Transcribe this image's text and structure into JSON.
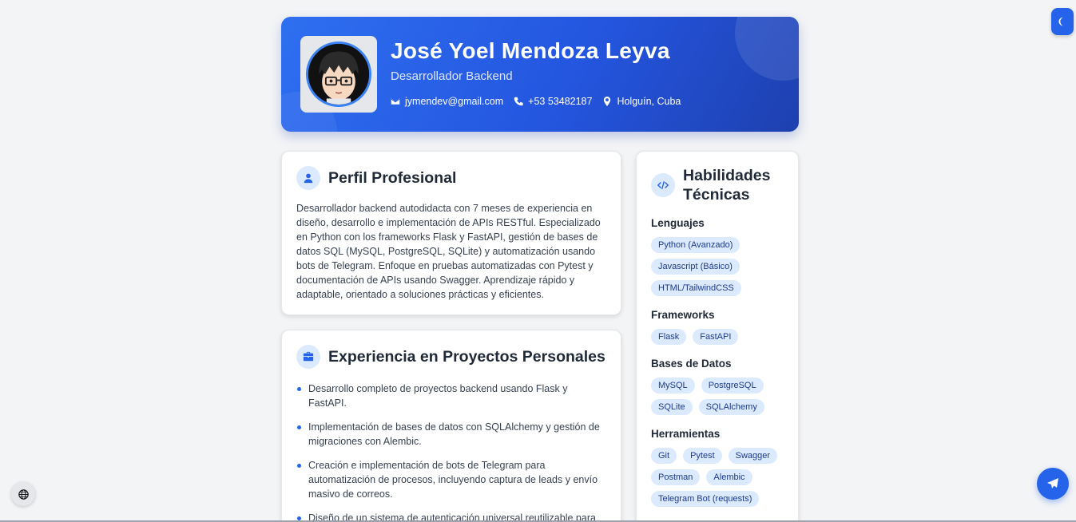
{
  "header": {
    "name": "José Yoel Mendoza Leyva",
    "role": "Desarrollador Backend",
    "email": "jymendev@gmail.com",
    "phone": "+53 53482187",
    "location": "Holguín, Cuba"
  },
  "perfil": {
    "title": "Perfil Profesional",
    "text": "Desarrollador backend autodidacta con 7 meses de experiencia en diseño, desarrollo e implementación de APIs RESTful. Especializado en Python con los frameworks Flask y FastAPI, gestión de bases de datos SQL (MySQL, PostgreSQL, SQLite) y automatización usando bots de Telegram. Enfoque en pruebas automatizadas con Pytest y documentación de APIs usando Swagger. Aprendizaje rápido y adaptable, orientado a soluciones prácticas y eficientes."
  },
  "experiencia": {
    "title": "Experiencia en Proyectos Personales",
    "items": [
      "Desarrollo completo de proyectos backend usando Flask y FastAPI.",
      "Implementación de bases de datos con SQLAlchemy y gestión de migraciones con Alembic.",
      "Creación e implementación de bots de Telegram para automatización de procesos, incluyendo captura de leads y envío masivo de correos.",
      "Diseño de un sistema de autenticación universal reutilizable para varios proyectos (web, servidores de juegos, IA)."
    ]
  },
  "habilidades": {
    "title": "Habilidades Técnicas",
    "groups": [
      {
        "name": "Lenguajes",
        "tags": [
          "Python (Avanzado)",
          "Javascript (Básico)",
          "HTML/TailwindCSS"
        ]
      },
      {
        "name": "Frameworks",
        "tags": [
          "Flask",
          "FastAPI"
        ]
      },
      {
        "name": "Bases de Datos",
        "tags": [
          "MySQL",
          "PostgreSQL",
          "SQLite",
          "SQLAlchemy"
        ]
      },
      {
        "name": "Herramientas",
        "tags": [
          "Git",
          "Pytest",
          "Swagger",
          "Postman",
          "Alembic",
          "Telegram Bot (requests)"
        ]
      }
    ]
  },
  "icons": {
    "theme": "moon-icon",
    "language": "globe-icon",
    "contact": "paper-plane-icon"
  },
  "colors": {
    "accent": "#2563eb",
    "header_gradient_start": "#2e6ff0",
    "header_gradient_end": "#1e40af",
    "tag_bg": "#dbeafe",
    "page_bg": "#f3f4f6"
  }
}
